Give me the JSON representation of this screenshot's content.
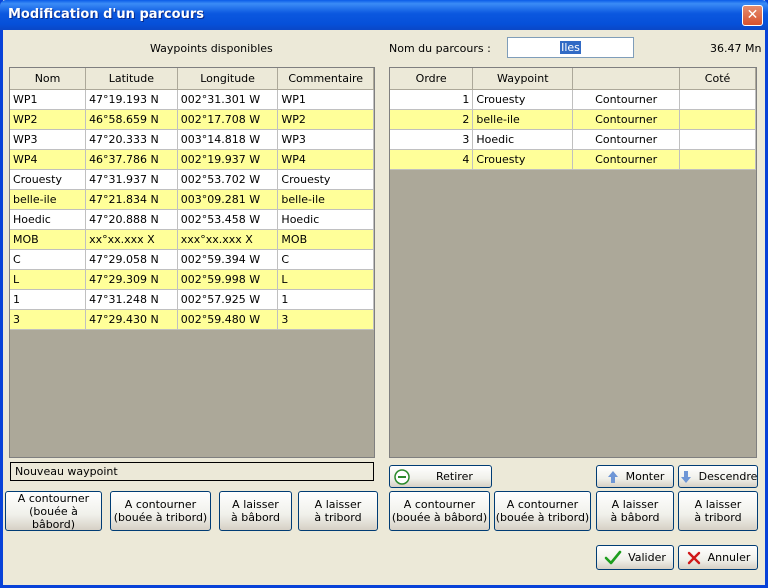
{
  "window": {
    "title": "Modification d'un parcours",
    "close_glyph": "✕"
  },
  "left_panel": {
    "heading": "Waypoints disponibles",
    "columns": [
      "Nom",
      "Latitude",
      "Longitude",
      "Commentaire"
    ],
    "rows": [
      [
        "WP1",
        "47°19.193 N",
        "002°31.301 W",
        "WP1"
      ],
      [
        "WP2",
        "46°58.659 N",
        "002°17.708 W",
        "WP2"
      ],
      [
        "WP3",
        "47°20.333 N",
        "003°14.818 W",
        "WP3"
      ],
      [
        "WP4",
        "46°37.786 N",
        "002°19.937 W",
        "WP4"
      ],
      [
        "Crouesty",
        "47°31.937 N",
        "002°53.702 W",
        "Crouesty"
      ],
      [
        "belle-ile",
        "47°21.834 N",
        "003°09.281 W",
        "belle-ile"
      ],
      [
        "Hoedic",
        "47°20.888 N",
        "002°53.458 W",
        "Hoedic"
      ],
      [
        "MOB",
        "xx°xx.xxx X",
        "xxx°xx.xxx X",
        "MOB"
      ],
      [
        "C",
        "47°29.058 N",
        "002°59.394 W",
        "C"
      ],
      [
        "L",
        "47°29.309 N",
        "002°59.998 W",
        "L"
      ],
      [
        "1",
        "47°31.248 N",
        "002°57.925 W",
        "1"
      ],
      [
        "3",
        "47°29.430 N",
        "002°59.480 W",
        "3"
      ]
    ],
    "new_waypoint_label": "Nouveau waypoint",
    "buttons": [
      {
        "line1": "A contourner",
        "line2": "(bouée à bâbord)"
      },
      {
        "line1": "A contourner",
        "line2": "(bouée à tribord)"
      },
      {
        "line1": "A laisser",
        "line2": "à bâbord"
      },
      {
        "line1": "A laisser",
        "line2": "à tribord"
      }
    ]
  },
  "route": {
    "name_label": "Nom du parcours :",
    "name_value": "Iles",
    "distance": "36.47 Mn",
    "columns": [
      "Ordre",
      "Waypoint",
      "",
      "Coté"
    ],
    "rows": [
      [
        "1",
        "Crouesty",
        "Contourner",
        ""
      ],
      [
        "2",
        "belle-ile",
        "Contourner",
        ""
      ],
      [
        "3",
        "Hoedic",
        "Contourner",
        ""
      ],
      [
        "4",
        "Crouesty",
        "Contourner",
        ""
      ]
    ],
    "retirer_label": "Retirer",
    "monter_label": "Monter",
    "descendre_label": "Descendre",
    "buttons": [
      {
        "line1": "A contourner",
        "line2": "(bouée à bâbord)"
      },
      {
        "line1": "A contourner",
        "line2": "(bouée à tribord)"
      },
      {
        "line1": "A laisser",
        "line2": "à bâbord"
      },
      {
        "line1": "A laisser",
        "line2": "à tribord"
      }
    ]
  },
  "footer": {
    "valider_label": "Valider",
    "annuler_label": "Annuler"
  },
  "colors": {
    "row_alt": "#ffff99",
    "grid_bg": "#aca899",
    "title_blue": "#0a58e0",
    "ok_green": "#1e9e1e",
    "cancel_red": "#d01818"
  },
  "icons": [
    "close-icon",
    "minus-circle-icon",
    "arrow-up-icon",
    "arrow-down-icon",
    "check-icon",
    "cross-icon"
  ]
}
